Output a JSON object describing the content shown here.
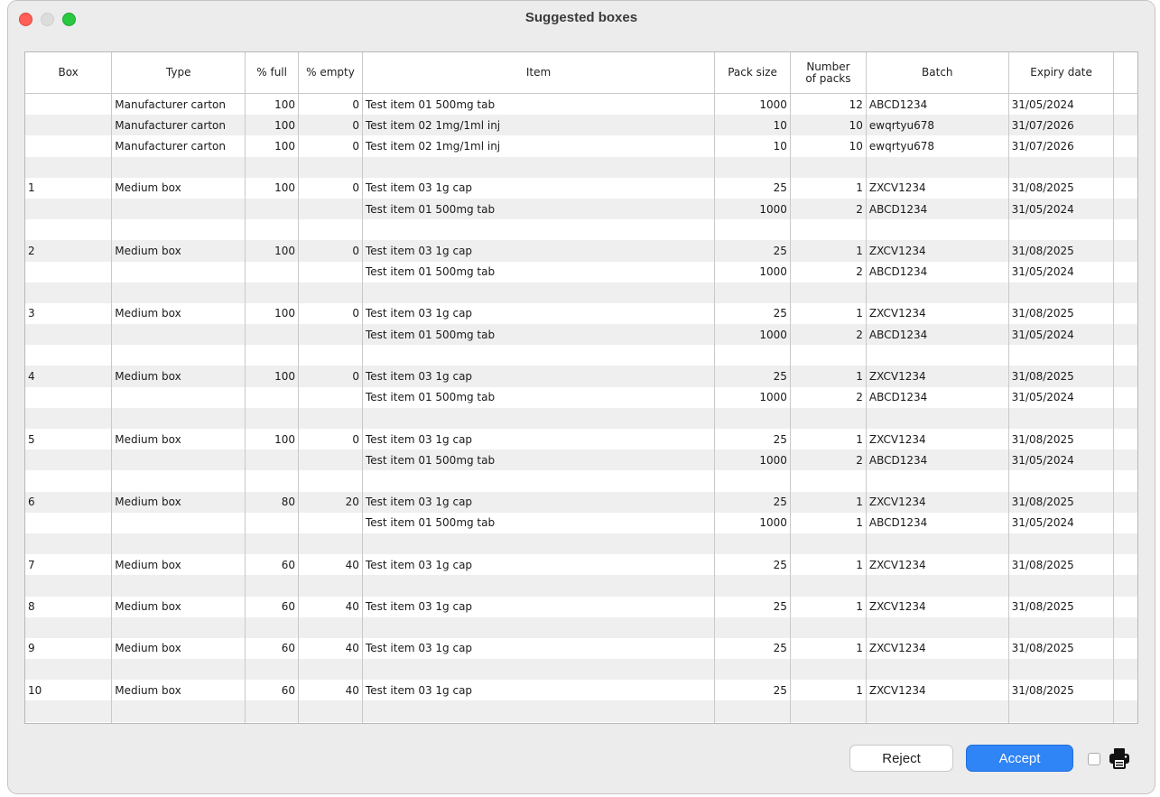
{
  "window": {
    "title": "Suggested boxes"
  },
  "table": {
    "columns": [
      "Box",
      "Type",
      "% full",
      "% empty",
      "Item",
      "Pack size",
      "Number of packs",
      "Batch",
      "Expiry date"
    ],
    "rows": [
      [
        "",
        "Manufacturer carton",
        "100",
        "0",
        "Test item 01 500mg tab",
        "1000",
        "12",
        "ABCD1234",
        "31/05/2024"
      ],
      [
        "",
        "Manufacturer carton",
        "100",
        "0",
        "Test item 02 1mg/1ml inj",
        "10",
        "10",
        "ewqrtyu678",
        "31/07/2026"
      ],
      [
        "",
        "Manufacturer carton",
        "100",
        "0",
        "Test item 02 1mg/1ml inj",
        "10",
        "10",
        "ewqrtyu678",
        "31/07/2026"
      ],
      [
        "",
        "",
        "",
        "",
        "",
        "",
        "",
        "",
        ""
      ],
      [
        "1",
        "Medium box",
        "100",
        "0",
        "Test item 03 1g cap",
        "25",
        "1",
        "ZXCV1234",
        "31/08/2025"
      ],
      [
        "",
        "",
        "",
        "",
        "Test item 01 500mg tab",
        "1000",
        "2",
        "ABCD1234",
        "31/05/2024"
      ],
      [
        "",
        "",
        "",
        "",
        "",
        "",
        "",
        "",
        ""
      ],
      [
        "2",
        "Medium box",
        "100",
        "0",
        "Test item 03 1g cap",
        "25",
        "1",
        "ZXCV1234",
        "31/08/2025"
      ],
      [
        "",
        "",
        "",
        "",
        "Test item 01 500mg tab",
        "1000",
        "2",
        "ABCD1234",
        "31/05/2024"
      ],
      [
        "",
        "",
        "",
        "",
        "",
        "",
        "",
        "",
        ""
      ],
      [
        "3",
        "Medium box",
        "100",
        "0",
        "Test item 03 1g cap",
        "25",
        "1",
        "ZXCV1234",
        "31/08/2025"
      ],
      [
        "",
        "",
        "",
        "",
        "Test item 01 500mg tab",
        "1000",
        "2",
        "ABCD1234",
        "31/05/2024"
      ],
      [
        "",
        "",
        "",
        "",
        "",
        "",
        "",
        "",
        ""
      ],
      [
        "4",
        "Medium box",
        "100",
        "0",
        "Test item 03 1g cap",
        "25",
        "1",
        "ZXCV1234",
        "31/08/2025"
      ],
      [
        "",
        "",
        "",
        "",
        "Test item 01 500mg tab",
        "1000",
        "2",
        "ABCD1234",
        "31/05/2024"
      ],
      [
        "",
        "",
        "",
        "",
        "",
        "",
        "",
        "",
        ""
      ],
      [
        "5",
        "Medium box",
        "100",
        "0",
        "Test item 03 1g cap",
        "25",
        "1",
        "ZXCV1234",
        "31/08/2025"
      ],
      [
        "",
        "",
        "",
        "",
        "Test item 01 500mg tab",
        "1000",
        "2",
        "ABCD1234",
        "31/05/2024"
      ],
      [
        "",
        "",
        "",
        "",
        "",
        "",
        "",
        "",
        ""
      ],
      [
        "6",
        "Medium box",
        "80",
        "20",
        "Test item 03 1g cap",
        "25",
        "1",
        "ZXCV1234",
        "31/08/2025"
      ],
      [
        "",
        "",
        "",
        "",
        "Test item 01 500mg tab",
        "1000",
        "1",
        "ABCD1234",
        "31/05/2024"
      ],
      [
        "",
        "",
        "",
        "",
        "",
        "",
        "",
        "",
        ""
      ],
      [
        "7",
        "Medium box",
        "60",
        "40",
        "Test item 03 1g cap",
        "25",
        "1",
        "ZXCV1234",
        "31/08/2025"
      ],
      [
        "",
        "",
        "",
        "",
        "",
        "",
        "",
        "",
        ""
      ],
      [
        "8",
        "Medium box",
        "60",
        "40",
        "Test item 03 1g cap",
        "25",
        "1",
        "ZXCV1234",
        "31/08/2025"
      ],
      [
        "",
        "",
        "",
        "",
        "",
        "",
        "",
        "",
        ""
      ],
      [
        "9",
        "Medium box",
        "60",
        "40",
        "Test item 03 1g cap",
        "25",
        "1",
        "ZXCV1234",
        "31/08/2025"
      ],
      [
        "",
        "",
        "",
        "",
        "",
        "",
        "",
        "",
        ""
      ],
      [
        "10",
        "Medium box",
        "60",
        "40",
        "Test item 03 1g cap",
        "25",
        "1",
        "ZXCV1234",
        "31/08/2025"
      ],
      [
        "",
        "",
        "",
        "",
        "",
        "",
        "",
        "",
        ""
      ],
      [
        "",
        "",
        "",
        "",
        "",
        "",
        "",
        "",
        ""
      ]
    ]
  },
  "footer": {
    "reject_label": "Reject",
    "accept_label": "Accept",
    "print_checkbox_checked": false,
    "print_icon": "printer-icon"
  },
  "colors": {
    "accent": "#2f84f6",
    "close": "#ff5f57",
    "maximize": "#28c840",
    "row_stripe": "#efefef"
  }
}
